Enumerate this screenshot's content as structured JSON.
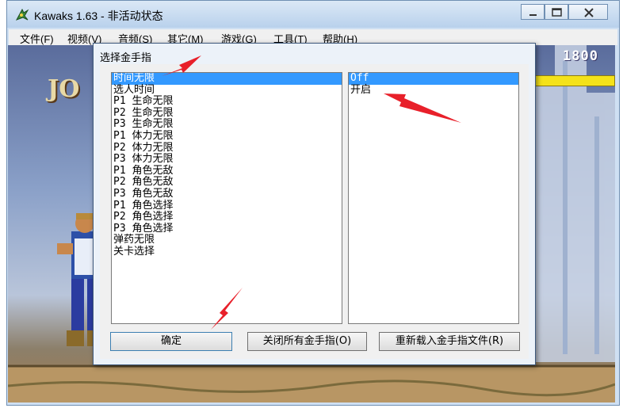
{
  "window": {
    "title": "Kawaks 1.63 - 非活动状态",
    "icon": "kawaks-app-icon",
    "controls": [
      "minimize-icon",
      "maximize-icon",
      "close-icon"
    ]
  },
  "menu": {
    "items": [
      "文件(F)",
      "视频(V)",
      "音频(S)",
      "其它(M)",
      "游戏(G)",
      "工具(T)",
      "帮助(H)"
    ]
  },
  "game": {
    "score": "1800",
    "player_name": "JO"
  },
  "dialog": {
    "title": "选择金手指",
    "cheats": [
      "时间无限",
      "选人时间",
      "P1 生命无限",
      "P2 生命无限",
      "P3 生命无限",
      "P1 体力无限",
      "P2 体力无限",
      "P3 体力无限",
      "P1 角色无敌",
      "P2 角色无敌",
      "P3 角色无敌",
      "P1 角色选择",
      "P2 角色选择",
      "P3 角色选择",
      "弹药无限",
      "关卡选择"
    ],
    "selected_cheat_index": 0,
    "options": [
      "Off",
      "开启"
    ],
    "selected_option_index": 0,
    "buttons": {
      "ok": "确定",
      "close_all": "关闭所有金手指(O)",
      "reload": "重新载入金手指文件(R)"
    }
  },
  "colors": {
    "selection": "#3399ff",
    "annotation_arrow": "#e8202a",
    "health_bar": "#f4e21a"
  }
}
